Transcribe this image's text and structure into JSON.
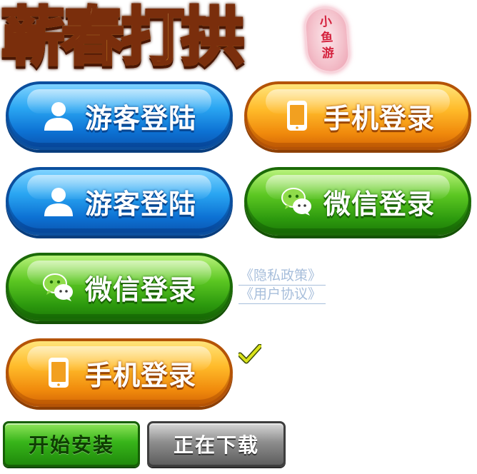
{
  "title": "蕲春打拱",
  "badge": "小\n鱼\n游",
  "buttons": {
    "guest_login_1": "游客登陆",
    "phone_login_1": "手机登录",
    "guest_login_2": "游客登陆",
    "wechat_login_1": "微信登录",
    "wechat_login_2": "微信登录",
    "phone_login_2": "手机登录",
    "start_install": "开始安装",
    "downloading": "正在下载"
  },
  "links": {
    "privacy": "《隐私政策》",
    "agreement": "《用户协议》"
  },
  "icons": {
    "guest": "user-icon",
    "phone": "phone-icon",
    "wechat": "wechat-icon",
    "check": "checkmark-icon"
  },
  "colors": {
    "blue": "#1a8fe6",
    "orange": "#f7a21a",
    "green": "#3fae16",
    "gray": "#7a7a7a",
    "link": "#a7bedb",
    "check": "#d9e21a"
  }
}
